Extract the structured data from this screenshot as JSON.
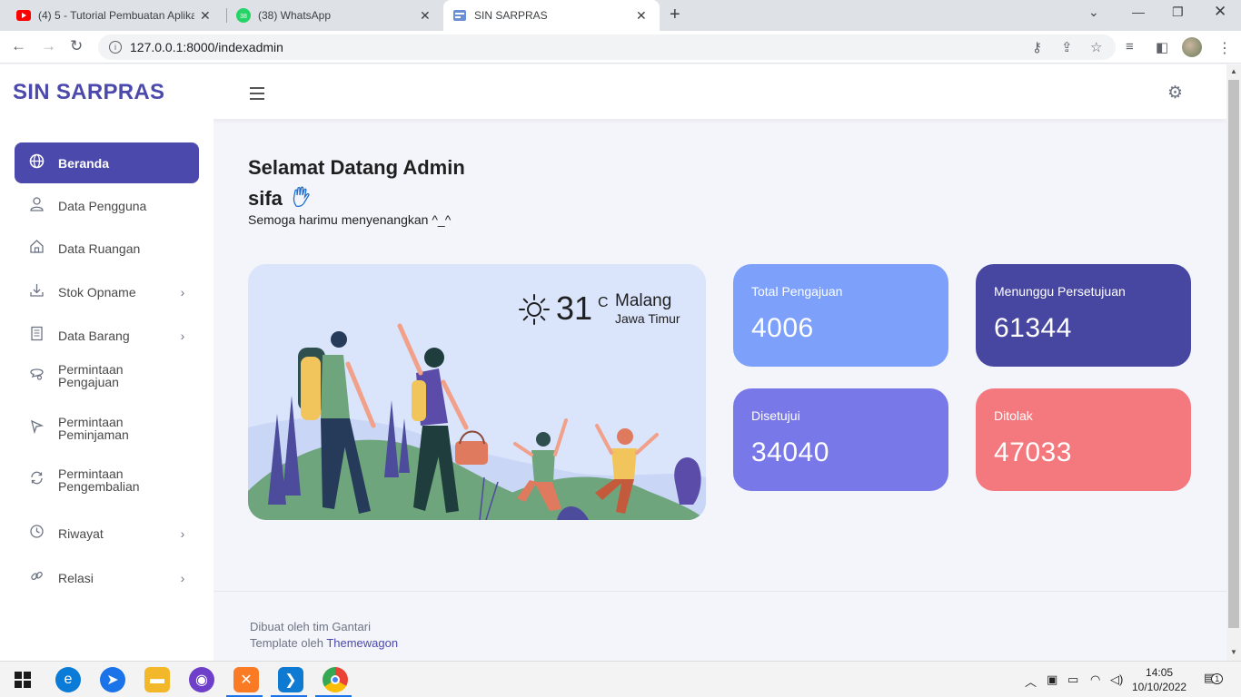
{
  "browser": {
    "tabs": [
      {
        "title": "(4) 5 - Tutorial Pembuatan Aplika",
        "icon": "youtube-icon",
        "active": false
      },
      {
        "title": "(38) WhatsApp",
        "icon": "whatsapp-icon",
        "badge": "38",
        "active": false
      },
      {
        "title": "SIN SARPRAS",
        "icon": "site-icon",
        "active": true
      }
    ],
    "url": "127.0.0.1:8000/indexadmin"
  },
  "header": {
    "brand": "SIN SARPRAS"
  },
  "sidebar": {
    "items": [
      {
        "label": "Beranda",
        "icon": "globe-icon",
        "active": true,
        "has_arrow": false
      },
      {
        "label": "Data Pengguna",
        "icon": "user-icon",
        "active": false,
        "has_arrow": false
      },
      {
        "label": "Data Ruangan",
        "icon": "home-icon",
        "active": false,
        "has_arrow": false
      },
      {
        "label": "Stok Opname",
        "icon": "download-icon",
        "active": false,
        "has_arrow": true
      },
      {
        "label": "Data Barang",
        "icon": "document-icon",
        "active": false,
        "has_arrow": true
      },
      {
        "label_line1": "Permintaan",
        "label_line2": "Pengajuan",
        "icon": "chat-icon",
        "active": false,
        "has_arrow": false
      },
      {
        "label_line1": "Permintaan",
        "label_line2": "Peminjaman",
        "icon": "send-icon",
        "active": false,
        "has_arrow": false
      },
      {
        "label_line1": "Permintaan",
        "label_line2": "Pengembalian",
        "icon": "refresh-icon",
        "active": false,
        "has_arrow": false
      },
      {
        "label": "Riwayat",
        "icon": "clock-icon",
        "active": false,
        "has_arrow": true
      },
      {
        "label": "Relasi",
        "icon": "link-icon",
        "active": false,
        "has_arrow": true
      }
    ]
  },
  "main": {
    "welcome_line1": "Selamat Datang Admin",
    "welcome_line2": "sifa",
    "subtitle": "Semoga harimu menyenangkan ^_^",
    "weather": {
      "temperature": "31",
      "unit": "C",
      "city": "Malang",
      "region": "Jawa Timur"
    },
    "stats": [
      {
        "label": "Total Pengajuan",
        "value": "4006",
        "color": "#7da0fa"
      },
      {
        "label": "Menunggu Persetujuan",
        "value": "61344",
        "color": "#4747a1"
      },
      {
        "label": "Disetujui",
        "value": "34040",
        "color": "#7978e9"
      },
      {
        "label": "Ditolak",
        "value": "47033",
        "color": "#f3797e"
      }
    ]
  },
  "footer": {
    "line1": "Dibuat oleh tim Gantari",
    "line2_prefix": "Template oleh ",
    "line2_link": "Themewagon"
  },
  "taskbar": {
    "time": "14:05",
    "date": "10/10/2022",
    "notification_count": "1"
  }
}
